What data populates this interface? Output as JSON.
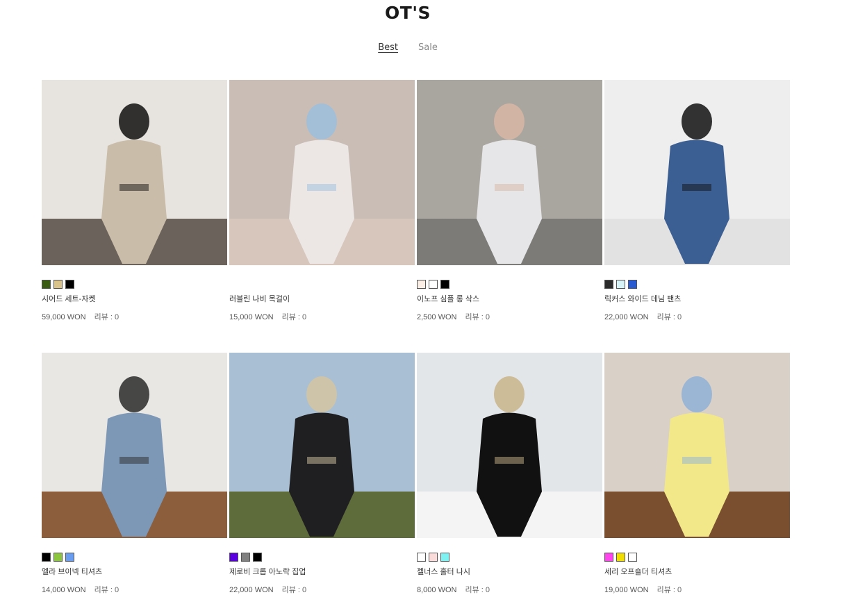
{
  "brand": "OT'S",
  "tabs": [
    {
      "label": "Best",
      "active": true
    },
    {
      "label": "Sale",
      "active": false
    }
  ],
  "review_label": "리뷰 : ",
  "products": [
    {
      "name": "시어드 세트-자켓",
      "price": "59,000 WON",
      "reviews": "0",
      "colors": [
        "#3a5c12",
        "#d9c38a",
        "#000000"
      ],
      "photo": {
        "bg": "#e7e4df",
        "floor": "#6b625b",
        "figure": "#c9bca9",
        "accent": "#111111"
      }
    },
    {
      "name": "러블린 나비 목걸이",
      "price": "15,000 WON",
      "reviews": "0",
      "colors": [],
      "photo": {
        "bg": "#c9bdb6",
        "floor": "#d7c6bc",
        "figure": "#ece7e4",
        "accent": "#9cc0dd"
      }
    },
    {
      "name": "이노프 심플 롱 삭스",
      "price": "2,500 WON",
      "reviews": "0",
      "colors": [
        "#fbeee6",
        "#ffffff",
        "#000000"
      ],
      "photo": {
        "bg": "#a9a59f",
        "floor": "#7d7b78",
        "figure": "#e6e6e8",
        "accent": "#d8b6a3"
      }
    },
    {
      "name": "릭커스 와이드 데님 팬츠",
      "price": "22,000 WON",
      "reviews": "0",
      "colors": [
        "#2b2b2b",
        "#d8f3f8",
        "#2a5bd0"
      ],
      "photo": {
        "bg": "#eeeeee",
        "floor": "#e2e2e2",
        "figure": "#3c5f93",
        "accent": "#111111"
      }
    },
    {
      "name": "엘라 브이넥 티셔츠",
      "price": "14,000 WON",
      "reviews": "0",
      "colors": [
        "#000000",
        "#8cc63f",
        "#6a9cf0"
      ],
      "photo": {
        "bg": "#e9e7e4",
        "floor": "#8c5e3c",
        "figure": "#7d98b6",
        "accent": "#2a2a2a"
      }
    },
    {
      "name": "제로비 크롭 아노락 집업",
      "price": "22,000 WON",
      "reviews": "0",
      "colors": [
        "#5a00e0",
        "#808080",
        "#000000"
      ],
      "photo": {
        "bg": "#a9bfd3",
        "floor": "#5e6b3a",
        "figure": "#1f1f22",
        "accent": "#d3c4a1"
      }
    },
    {
      "name": "젤너스 홀터 나시",
      "price": "8,000 WON",
      "reviews": "0",
      "colors": [
        "#ffffff",
        "#fbdada",
        "#7ef2f2"
      ],
      "photo": {
        "bg": "#e3e6e8",
        "floor": "#f4f4f4",
        "figure": "#111111",
        "accent": "#c9b48a"
      }
    },
    {
      "name": "세리 오프숄더 티셔츠",
      "price": "19,000 WON",
      "reviews": "0",
      "colors": [
        "#ff44ee",
        "#f2dd00",
        "#ffffff"
      ],
      "photo": {
        "bg": "#d9d0c8",
        "floor": "#7a4f2f",
        "figure": "#f2e88a",
        "accent": "#8fb1d6"
      }
    }
  ]
}
